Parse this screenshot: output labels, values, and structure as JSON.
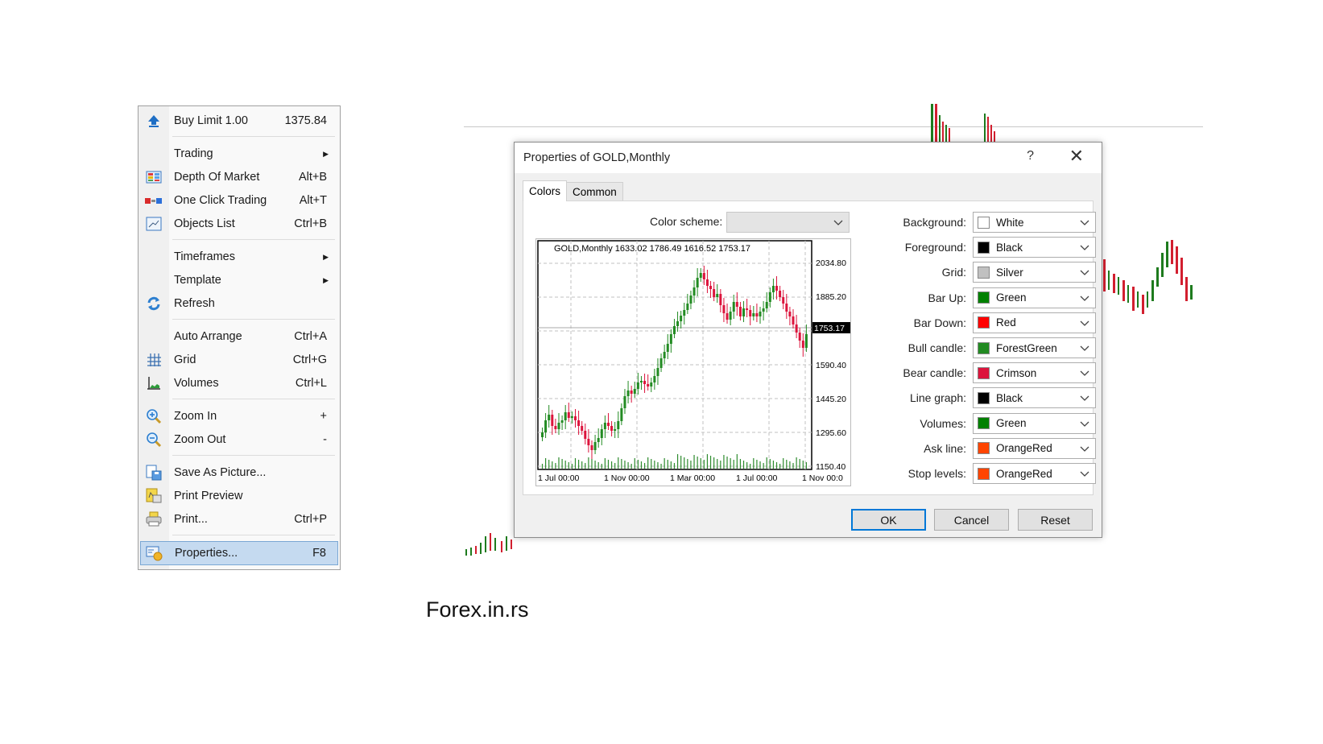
{
  "context_menu": {
    "items": [
      {
        "label": "Buy Limit 1.00",
        "shortcut": "1375.84",
        "icon": "buy-limit-arrow-icon"
      },
      {
        "label": "Trading",
        "shortcut": "",
        "submenu": true
      },
      {
        "label": "Depth Of Market",
        "shortcut": "Alt+B",
        "icon": "depth-of-market-icon"
      },
      {
        "label": "One Click Trading",
        "shortcut": "Alt+T",
        "icon": "one-click-trading-icon"
      },
      {
        "label": "Objects List",
        "shortcut": "Ctrl+B",
        "icon": "objects-list-icon"
      },
      {
        "label": "Timeframes",
        "shortcut": "",
        "submenu": true
      },
      {
        "label": "Template",
        "shortcut": "",
        "submenu": true
      },
      {
        "label": "Refresh",
        "shortcut": "",
        "icon": "refresh-icon"
      },
      {
        "label": "Auto Arrange",
        "shortcut": "Ctrl+A"
      },
      {
        "label": "Grid",
        "shortcut": "Ctrl+G",
        "icon": "grid-icon"
      },
      {
        "label": "Volumes",
        "shortcut": "Ctrl+L",
        "icon": "volumes-icon"
      },
      {
        "label": "Zoom In",
        "shortcut": "+",
        "icon": "zoom-in-icon"
      },
      {
        "label": "Zoom Out",
        "shortcut": "-",
        "icon": "zoom-out-icon"
      },
      {
        "label": "Save As Picture...",
        "shortcut": "",
        "icon": "save-picture-icon"
      },
      {
        "label": "Print Preview",
        "shortcut": "",
        "icon": "print-preview-icon"
      },
      {
        "label": "Print...",
        "shortcut": "Ctrl+P",
        "icon": "print-icon"
      },
      {
        "label": "Properties...",
        "shortcut": "F8",
        "icon": "properties-icon",
        "selected": true
      }
    ]
  },
  "dialog": {
    "title": "Properties of GOLD,Monthly",
    "help_label": "?",
    "close_label": "✕",
    "tabs": [
      {
        "label": "Colors",
        "active": true
      },
      {
        "label": "Common",
        "active": false
      }
    ],
    "color_scheme": {
      "label": "Color scheme:",
      "value": ""
    },
    "preview": {
      "header": "GOLD,Monthly   1633.02 1786.49 1616.52 1753.17",
      "current_price": "1753.17",
      "y_ticks": [
        "2034.80",
        "1885.20",
        "1590.40",
        "1445.20",
        "1295.60",
        "1150.40"
      ],
      "x_ticks": [
        "1 Jul 00:00",
        "1 Nov 00:00",
        "1 Mar 00:00",
        "1 Jul 00:00",
        "1 Nov 00:0"
      ]
    },
    "properties": [
      {
        "label": "Background:",
        "value": "White",
        "color": "#ffffff"
      },
      {
        "label": "Foreground:",
        "value": "Black",
        "color": "#000000"
      },
      {
        "label": "Grid:",
        "value": "Silver",
        "color": "#c0c0c0"
      },
      {
        "label": "Bar Up:",
        "value": "Green",
        "color": "#008000"
      },
      {
        "label": "Bar Down:",
        "value": "Red",
        "color": "#ff0000"
      },
      {
        "label": "Bull candle:",
        "value": "ForestGreen",
        "color": "#228b22"
      },
      {
        "label": "Bear candle:",
        "value": "Crimson",
        "color": "#dc143c"
      },
      {
        "label": "Line graph:",
        "value": "Black",
        "color": "#000000"
      },
      {
        "label": "Volumes:",
        "value": "Green",
        "color": "#008000"
      },
      {
        "label": "Ask line:",
        "value": "OrangeRed",
        "color": "#ff4500"
      },
      {
        "label": "Stop levels:",
        "value": "OrangeRed",
        "color": "#ff4500"
      }
    ],
    "buttons": {
      "ok": "OK",
      "cancel": "Cancel",
      "reset": "Reset"
    }
  },
  "watermark": "Forex.in.rs"
}
